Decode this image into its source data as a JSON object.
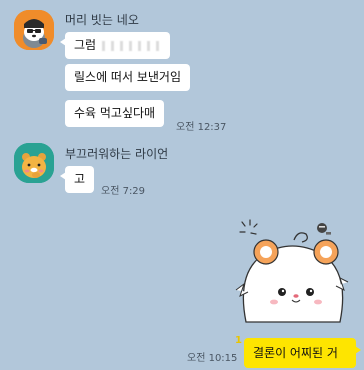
{
  "colors": {
    "background": "#b2c7da",
    "bubble_other": "#ffffff",
    "bubble_mine": "#fee500",
    "unread": "#e9c500"
  },
  "messages_group1": {
    "sender": "머리 빗는 네오",
    "avatar_icon": "neo-avatar-icon",
    "bubbles": [
      {
        "text": "그럼"
      },
      {
        "text": "릴스에 떠서 보낸거임"
      },
      {
        "text": "수육 먹고싶다매"
      }
    ],
    "time": "오전 12:37"
  },
  "messages_group2": {
    "sender": "부끄러워하는 라이언",
    "avatar_icon": "ryan-avatar-icon",
    "bubbles": [
      {
        "text": "고"
      }
    ],
    "time": "오전 7:29"
  },
  "my_messages": {
    "sticker_icon": "hamster-sticker-icon",
    "text": "결론이 어찌된 거",
    "time": "오전 10:15",
    "unread_count": "1"
  }
}
